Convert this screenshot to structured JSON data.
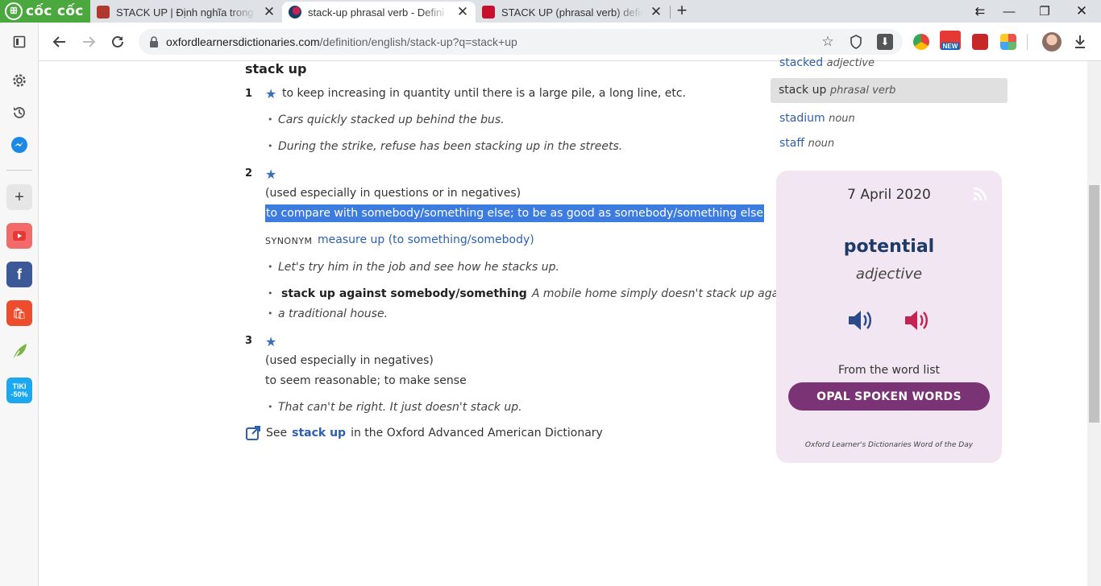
{
  "browser": {
    "brand": "cốc cốc",
    "tabs": [
      {
        "title": "STACK UP | Định nghĩa trong",
        "active": false
      },
      {
        "title": "stack-up phrasal verb - Defini",
        "active": true
      },
      {
        "title": "STACK UP (phrasal verb) defin",
        "active": false
      }
    ],
    "new_tab_symbol": "+",
    "window_controls": {
      "minimize": "—",
      "restore": "❐",
      "close": "✕",
      "extra": "⇇"
    },
    "url_domain": "oxfordlearnersdictionaries.com",
    "url_path": "/definition/english/stack-up?q=stack+up",
    "extension_badge": "NEW"
  },
  "sidebar": {
    "promo_badge": "TIKI -50%",
    "icons": [
      "sidebar-toggle-icon",
      "settings-icon",
      "history-icon",
      "messenger-icon",
      "add-icon",
      "youtube-icon",
      "facebook-icon",
      "shopee-icon",
      "leaf-icon",
      "tiki-icon"
    ]
  },
  "entry": {
    "headword": "stack up",
    "senses": [
      {
        "num": "1",
        "definition": "to keep increasing in quantity until there is a large pile, a long line, etc.",
        "examples": [
          "Cars quickly stacked up behind the bus.",
          "During the strike, refuse has been stacking up in the streets."
        ]
      },
      {
        "num": "2",
        "grammar": "(used especially in questions or in negatives)",
        "definition": "to compare with somebody/something else; to be as good as somebody/something else",
        "synonym_label": "SYNONYM",
        "synonym": "measure up (to something/somebody)",
        "examples": [
          "Let's try him in the job and see how he stacks up."
        ],
        "collocation": "stack up against somebody/something",
        "collocation_example_1": "A mobile home simply doesn't stack up against",
        "collocation_example_2": "a traditional house."
      },
      {
        "num": "3",
        "grammar": "(used especially in negatives)",
        "definition": "to seem reasonable; to make sense",
        "examples": [
          "That can't be right. It just doesn't stack up."
        ]
      }
    ],
    "see_also": {
      "prefix": "See",
      "link": "stack up",
      "suffix": "in the Oxford Advanced American Dictionary"
    }
  },
  "related": [
    {
      "word": "stacked",
      "pos": "adjective"
    },
    {
      "word": "stack up",
      "pos": "phrasal verb",
      "active": true
    },
    {
      "word": "stadium",
      "pos": "noun"
    },
    {
      "word": "staff",
      "pos": "noun"
    }
  ],
  "wotd": {
    "date": "7 April 2020",
    "word": "potential",
    "pos": "adjective",
    "from_label": "From the word list",
    "list_button": "OPAL SPOKEN WORDS",
    "footer": "Oxford Learner's Dictionaries Word of the Day",
    "colors": {
      "bg": "#f1e6f2",
      "button": "#7a3375",
      "uk_speaker": "#2b4a8c",
      "us_speaker": "#c4244f"
    }
  }
}
